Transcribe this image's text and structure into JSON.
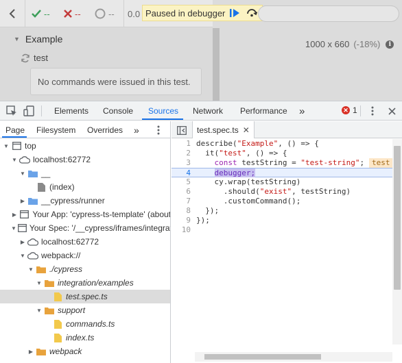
{
  "runner": {
    "stats": {
      "passed": "--",
      "failed": "--",
      "pending": "--",
      "duration": "0.0"
    },
    "debugger_banner": {
      "text": "Paused in debugger"
    },
    "suite": {
      "title": "Example",
      "test": "test"
    },
    "empty_commands": "No commands were issued in this test.",
    "viewport": {
      "size": "1000 x 660",
      "scale": "(-18%)"
    }
  },
  "devtools": {
    "tabs": [
      "Elements",
      "Console",
      "Sources",
      "Network",
      "Performance"
    ],
    "active_tab": "Sources",
    "more_tabs": "»",
    "error_count": "1",
    "navigator": {
      "tabs": [
        "Page",
        "Filesystem",
        "Overrides"
      ],
      "more": "»",
      "tree": [
        {
          "label": "top",
          "icon": "frame-icon"
        },
        {
          "label": "localhost:62772",
          "icon": "cloud-icon"
        },
        {
          "label": "__",
          "icon": "folder-icon"
        },
        {
          "label": "(index)",
          "icon": "file-icon"
        },
        {
          "label": "__cypress/runner",
          "icon": "folder-icon"
        },
        {
          "label": "Your App: 'cypress-ts-template' (about",
          "icon": "frame-icon"
        },
        {
          "label": "Your Spec: '/__cypress/iframes/integrat",
          "icon": "frame-icon"
        },
        {
          "label": "localhost:62772",
          "icon": "cloud-icon"
        },
        {
          "label": "webpack://",
          "icon": "cloud-icon"
        },
        {
          "label": "./cypress",
          "icon": "folder-icon"
        },
        {
          "label": "integration/examples",
          "icon": "folder-icon"
        },
        {
          "label": "test.spec.ts",
          "icon": "file-icon"
        },
        {
          "label": "support",
          "icon": "folder-icon"
        },
        {
          "label": "commands.ts",
          "icon": "file-icon"
        },
        {
          "label": "index.ts",
          "icon": "file-icon"
        },
        {
          "label": "webpack",
          "icon": "folder-icon"
        }
      ]
    },
    "editor": {
      "open_file": "test.spec.ts",
      "current_line": 4,
      "lines": [
        "describe(\"Example\", () => {",
        "  it(\"test\", () => {",
        "    const testString = \"test-string\";",
        "    debugger;",
        "    cy.wrap(testString)",
        "      .should(\"exist\", testString)",
        "      .customCommand();",
        "  });",
        "});",
        ""
      ],
      "inline_value": "test"
    },
    "colors": {
      "accent": "#1a73e8",
      "error": "#d93025",
      "folder": "#e8a33d",
      "file": "#f2c94c"
    }
  }
}
